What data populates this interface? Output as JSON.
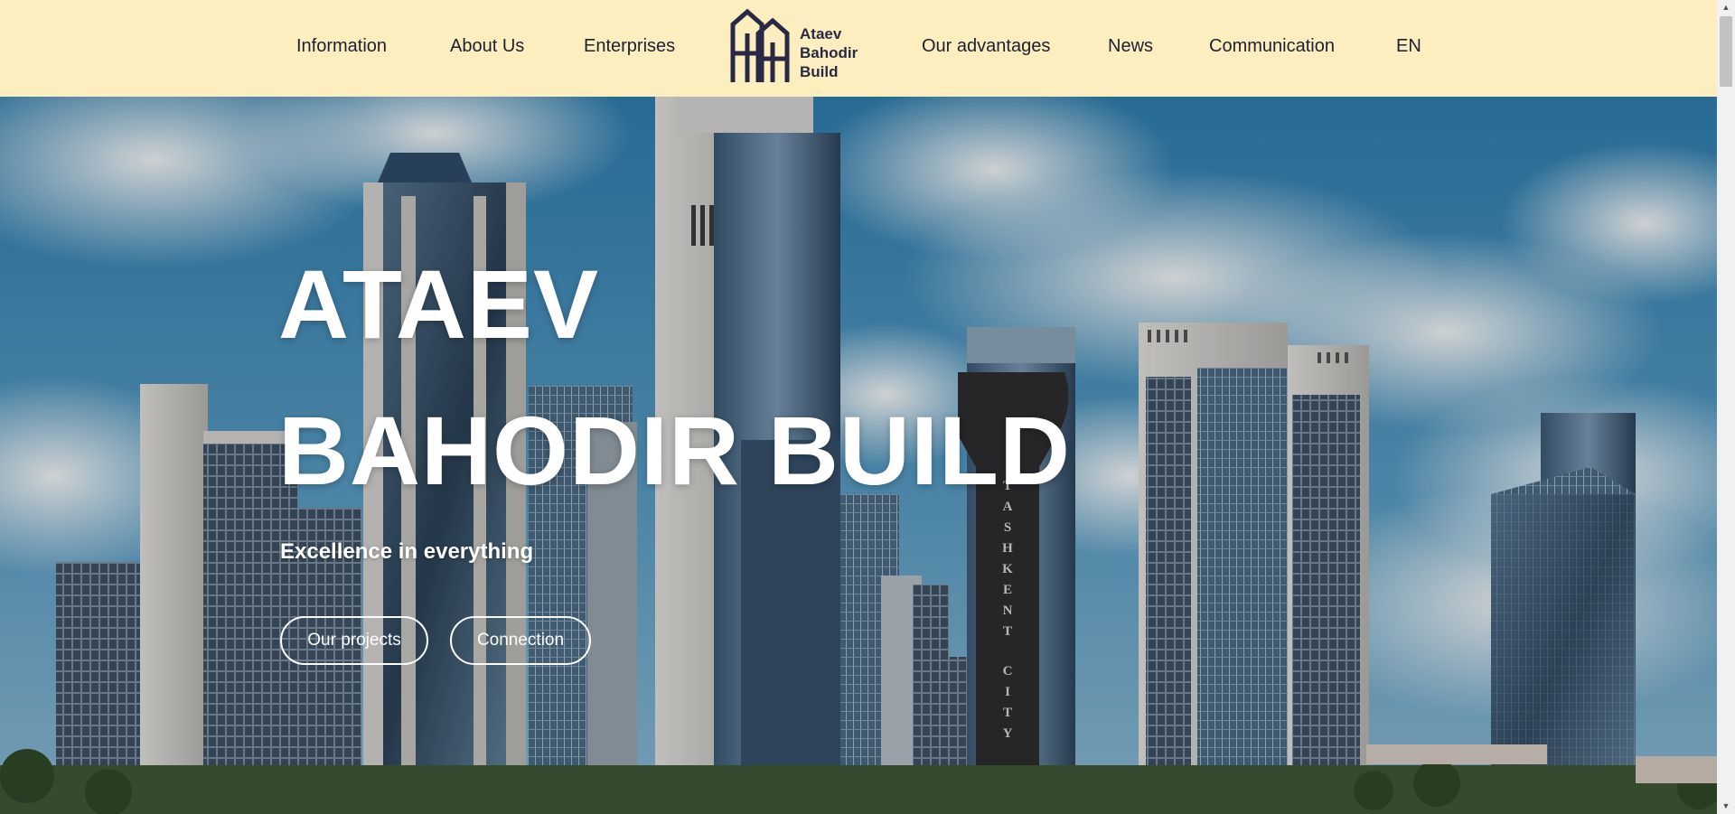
{
  "header": {
    "nav_left": [
      "Information",
      "About Us",
      "Enterprises"
    ],
    "nav_right": [
      "Our advantages",
      "News",
      "Communication"
    ],
    "language": "EN",
    "logo": {
      "line1": "Ataev",
      "line2": "Bahodir",
      "line3": "Build"
    },
    "background": "#fdeebf",
    "text_color": "#202032"
  },
  "hero": {
    "title_line1": "ATAEV",
    "title_line2": "BAHODIR BUILD",
    "subtitle": "Excellence in everything",
    "buttons": {
      "projects": "Our projects",
      "connection": "Connection"
    },
    "tower_sign": "TASHKENT CITY"
  },
  "scrollbar": {
    "up_icon": "arrow-up-icon",
    "down_icon": "arrow-down-icon"
  }
}
